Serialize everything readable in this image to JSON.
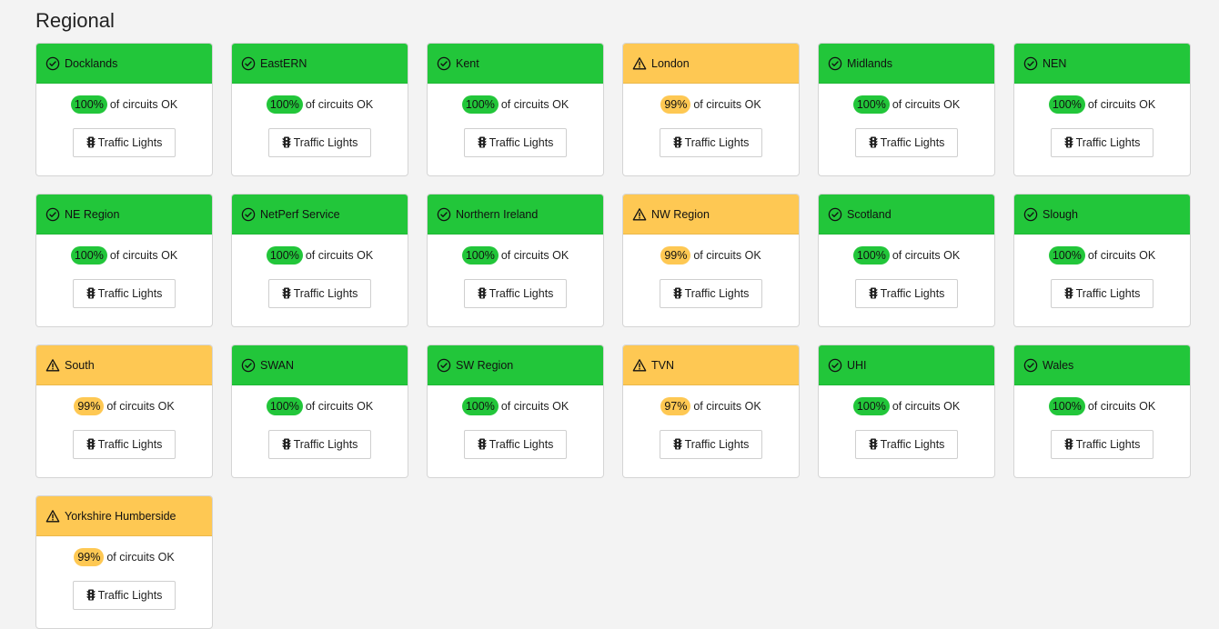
{
  "section_title": "Regional",
  "stat_suffix": "of circuits OK",
  "button_label": "Traffic Lights",
  "colors": {
    "ok": "#22c63a",
    "warn": "#fec853"
  },
  "icons": {
    "ok": "check-circle-icon",
    "warn": "warning-triangle-icon",
    "button": "traffic-light-icon"
  },
  "regions": [
    {
      "name": "Docklands",
      "status": "ok",
      "percent": "100%"
    },
    {
      "name": "EastERN",
      "status": "ok",
      "percent": "100%"
    },
    {
      "name": "Kent",
      "status": "ok",
      "percent": "100%"
    },
    {
      "name": "London",
      "status": "warn",
      "percent": "99%"
    },
    {
      "name": "Midlands",
      "status": "ok",
      "percent": "100%"
    },
    {
      "name": "NEN",
      "status": "ok",
      "percent": "100%"
    },
    {
      "name": "NE Region",
      "status": "ok",
      "percent": "100%"
    },
    {
      "name": "NetPerf Service",
      "status": "ok",
      "percent": "100%"
    },
    {
      "name": "Northern Ireland",
      "status": "ok",
      "percent": "100%"
    },
    {
      "name": "NW Region",
      "status": "warn",
      "percent": "99%"
    },
    {
      "name": "Scotland",
      "status": "ok",
      "percent": "100%"
    },
    {
      "name": "Slough",
      "status": "ok",
      "percent": "100%"
    },
    {
      "name": "South",
      "status": "warn",
      "percent": "99%"
    },
    {
      "name": "SWAN",
      "status": "ok",
      "percent": "100%"
    },
    {
      "name": "SW Region",
      "status": "ok",
      "percent": "100%"
    },
    {
      "name": "TVN",
      "status": "warn",
      "percent": "97%"
    },
    {
      "name": "UHI",
      "status": "ok",
      "percent": "100%"
    },
    {
      "name": "Wales",
      "status": "ok",
      "percent": "100%"
    },
    {
      "name": "Yorkshire Humberside",
      "status": "warn",
      "percent": "99%"
    }
  ]
}
